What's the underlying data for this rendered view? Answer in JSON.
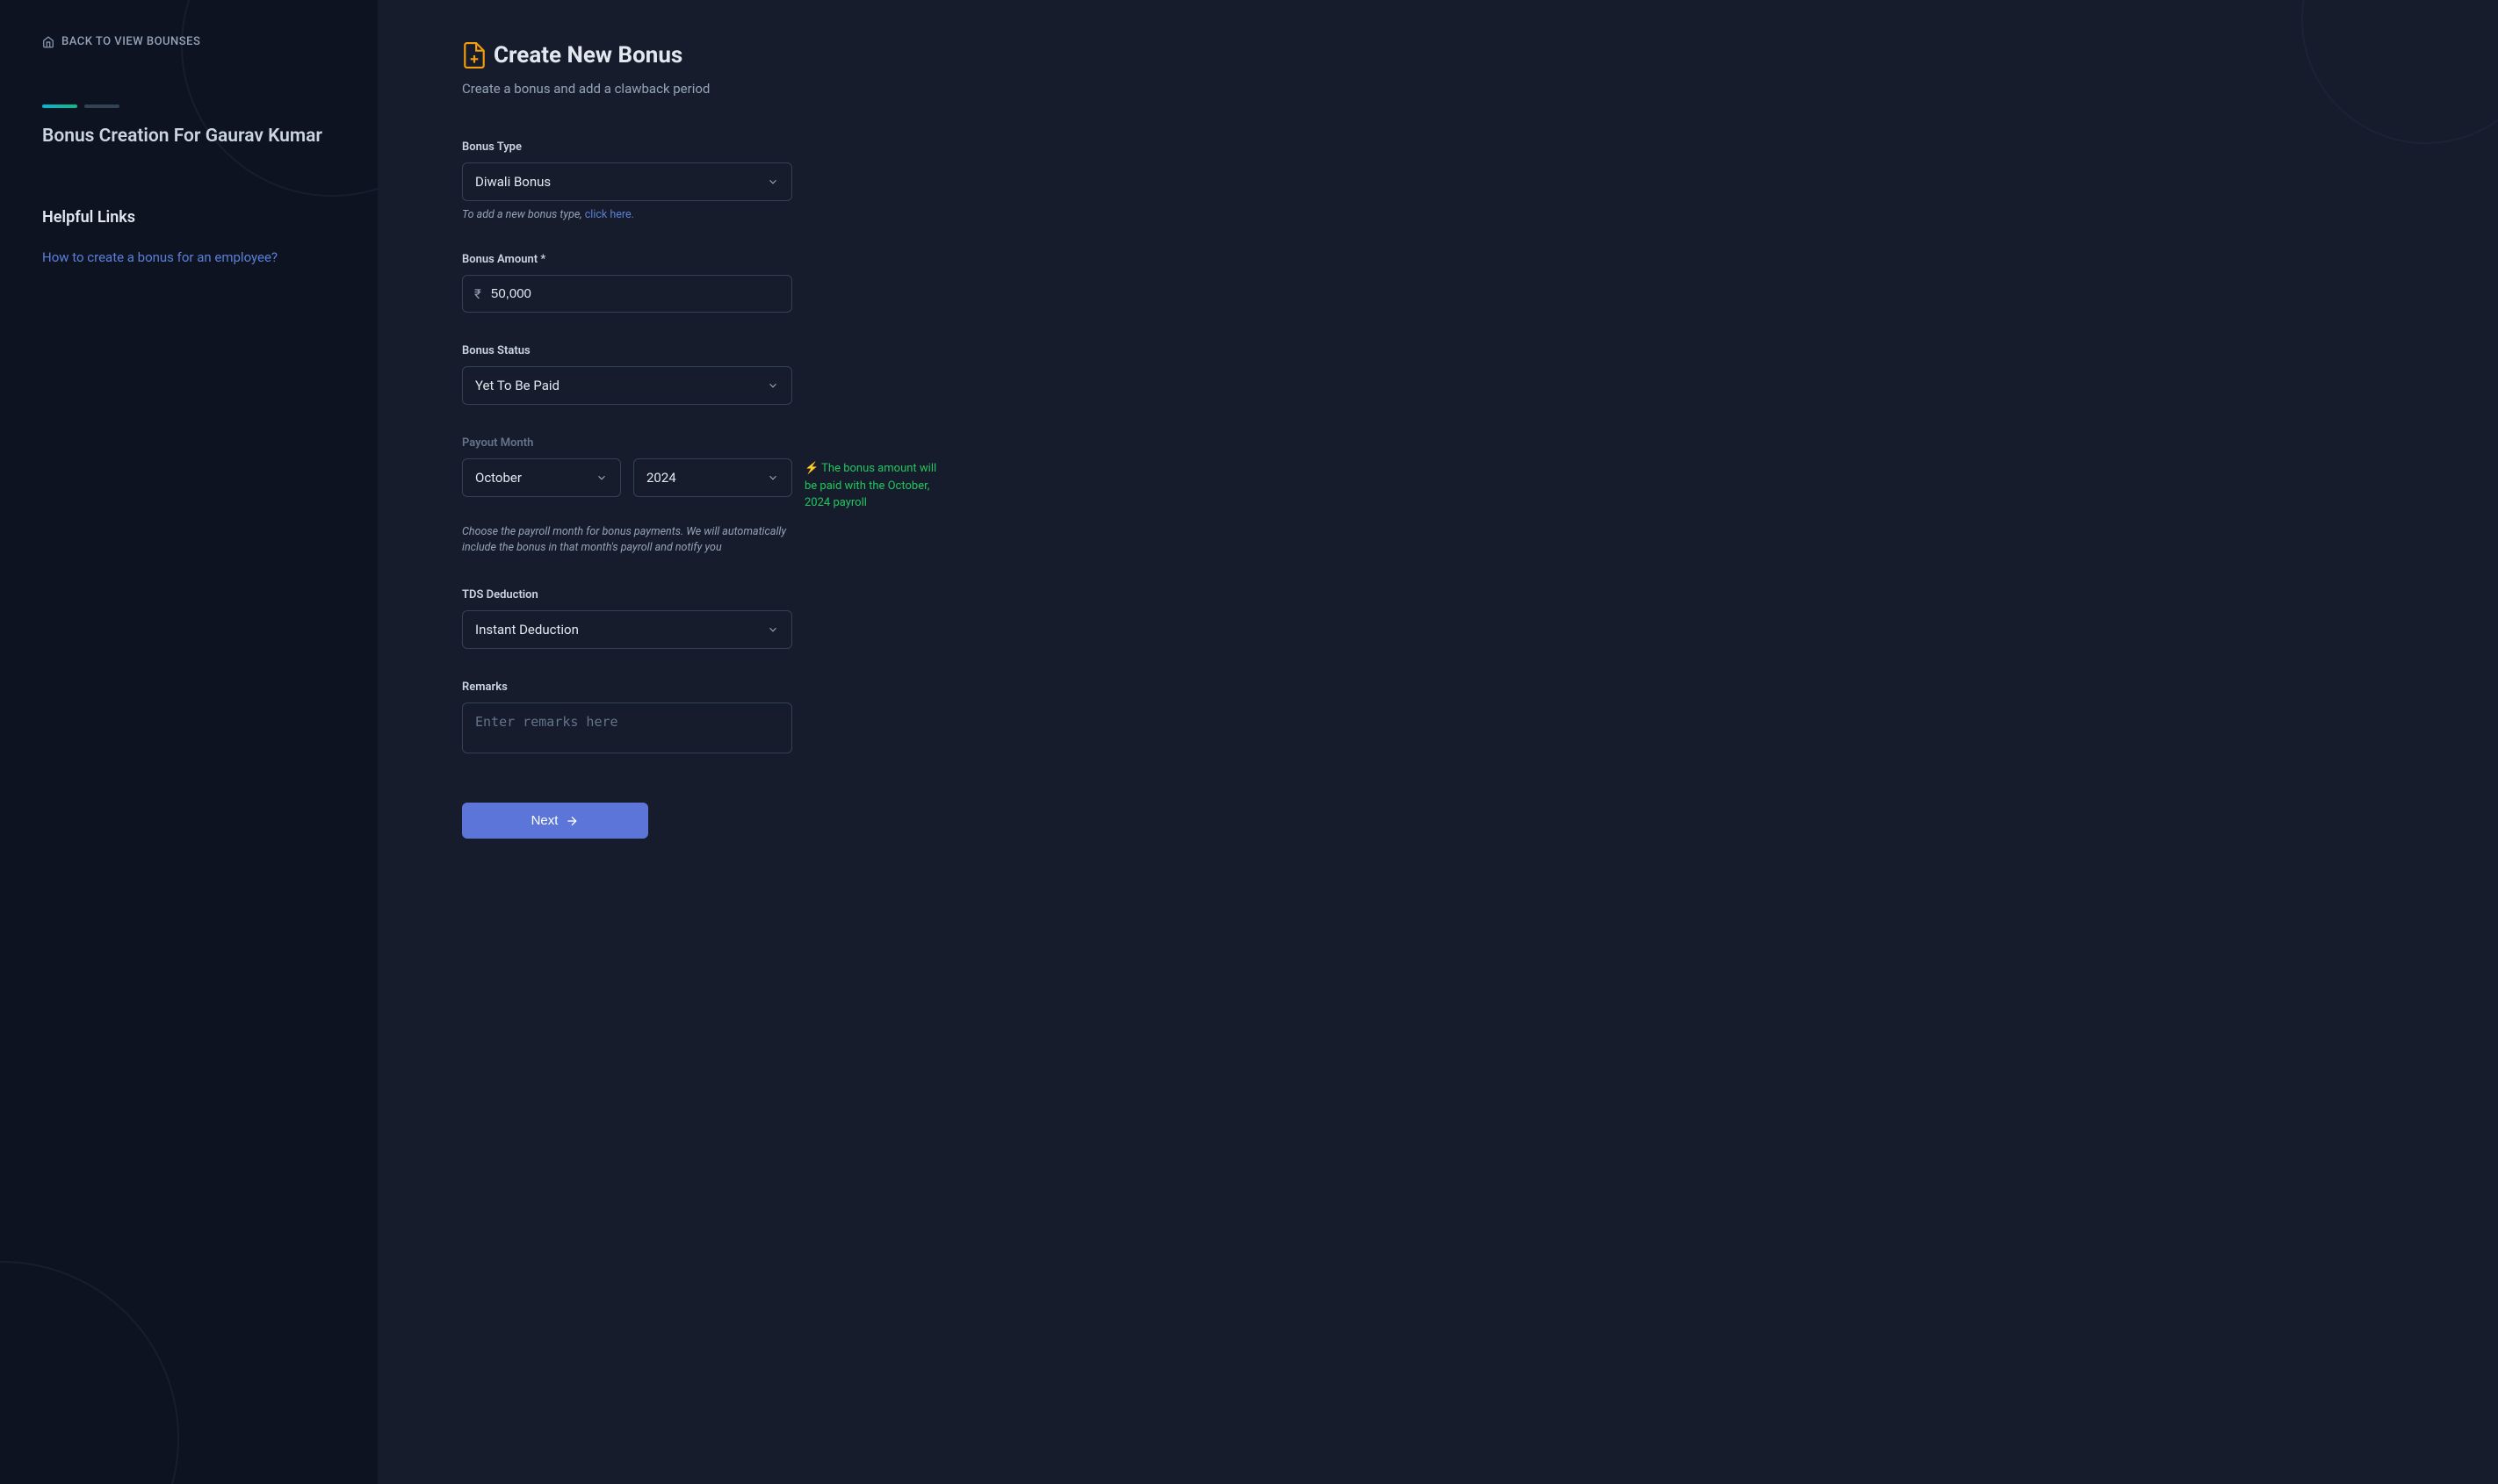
{
  "sidebar": {
    "back_label": "BACK TO VIEW BOUNSES",
    "title": "Bonus Creation For Gaurav Kumar",
    "helpful_links_title": "Helpful Links",
    "helpful_links": [
      {
        "label": "How to create a bonus for an employee?"
      }
    ]
  },
  "main": {
    "title": "Create New Bonus",
    "subtitle": "Create a bonus and add a clawback period",
    "form": {
      "bonus_type": {
        "label": "Bonus Type",
        "value": "Diwali Bonus",
        "helper_prefix": "To add a new bonus type, ",
        "helper_link": "click here."
      },
      "bonus_amount": {
        "label": "Bonus Amount *",
        "currency": "₹",
        "value": "50,000"
      },
      "bonus_status": {
        "label": "Bonus Status",
        "value": "Yet To Be Paid"
      },
      "payout_month": {
        "label": "Payout Month",
        "month": "October",
        "year": "2024",
        "note": "⚡ The bonus amount will be paid with the October, 2024 payroll",
        "helper": "Choose the payroll month for bonus payments. We will automatically include the bonus in that month's payroll and notify you"
      },
      "tds_deduction": {
        "label": "TDS Deduction",
        "value": "Instant Deduction"
      },
      "remarks": {
        "label": "Remarks",
        "placeholder": "Enter remarks here"
      },
      "next_button": "Next"
    }
  }
}
